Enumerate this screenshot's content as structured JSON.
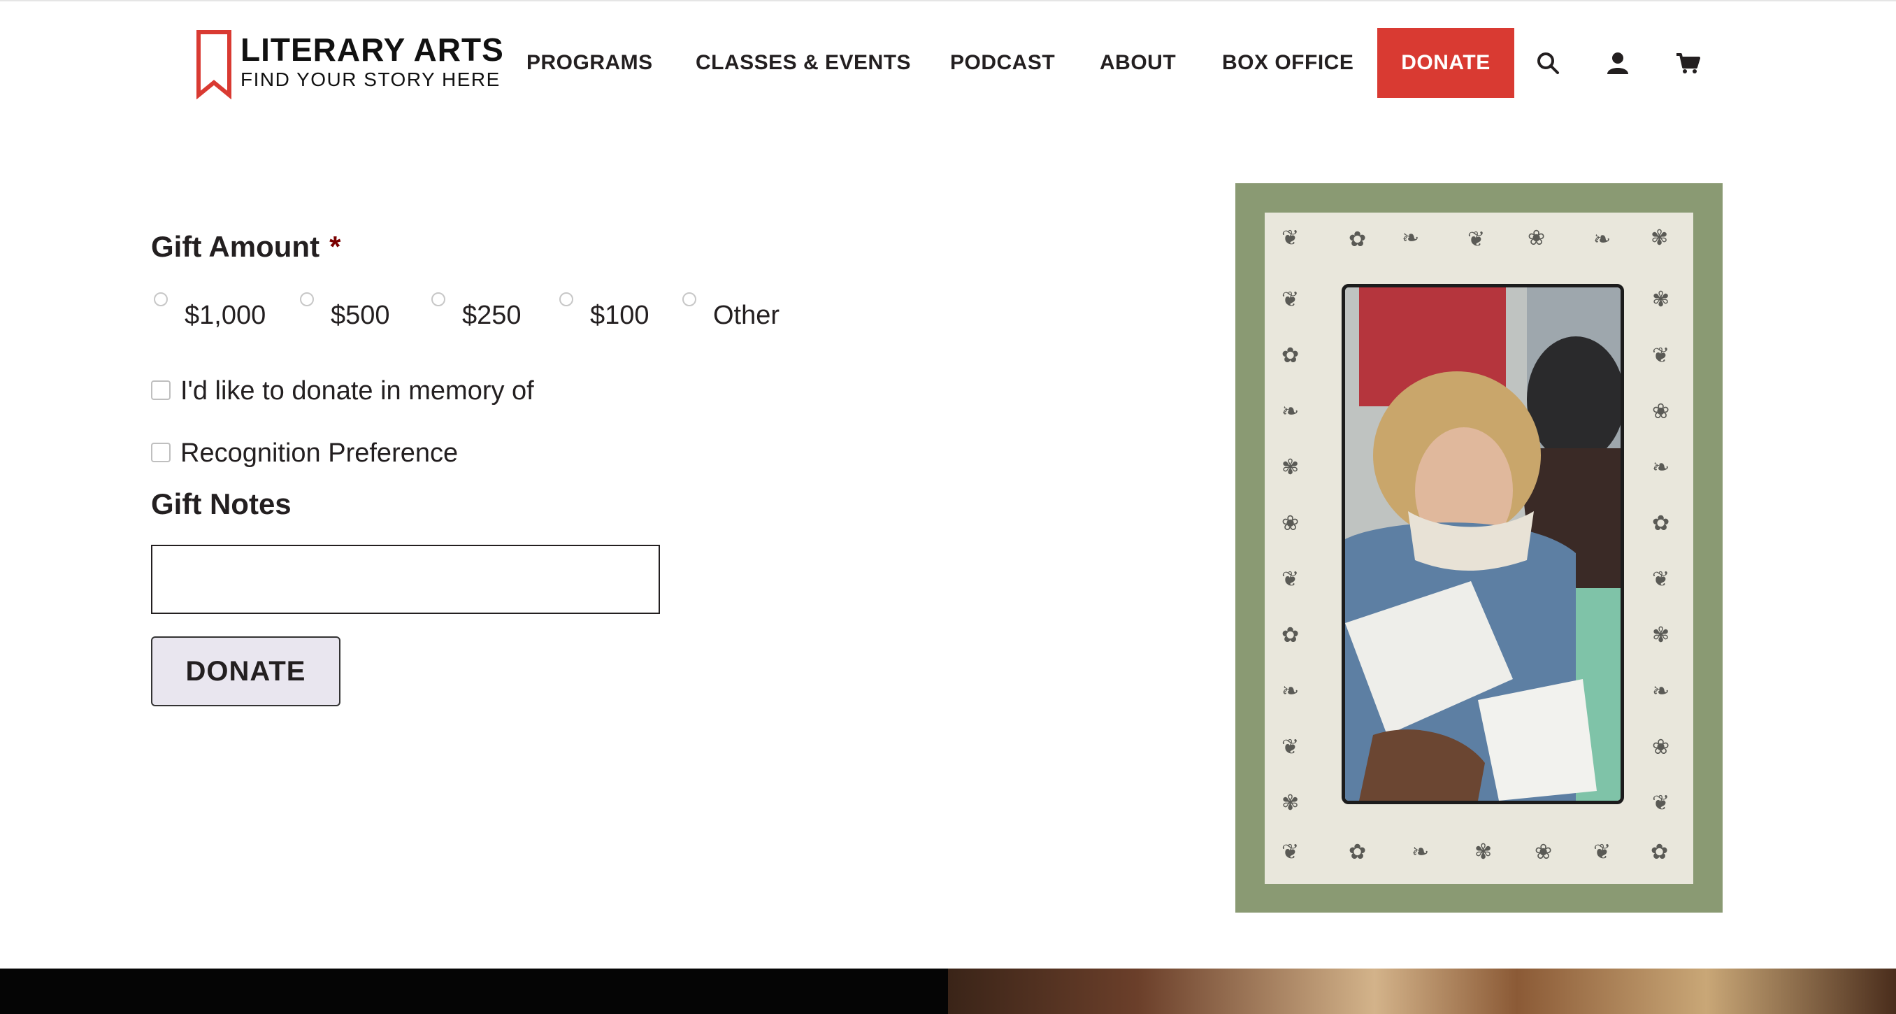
{
  "header": {
    "logo": {
      "title": "LITERARY ARTS",
      "tagline": "FIND YOUR STORY HERE",
      "color": "#d93a32"
    },
    "nav": {
      "programs": "PROGRAMS",
      "classes_events": "CLASSES & EVENTS",
      "podcast": "PODCAST",
      "about": "ABOUT",
      "box_office": "BOX OFFICE",
      "donate": "DONATE"
    },
    "icons": [
      "search-icon",
      "account-icon",
      "cart-icon"
    ],
    "accent_color": "#d93a32"
  },
  "form": {
    "gift_amount_label": "Gift Amount",
    "required_marker": "*",
    "amount_options": [
      "$1,000",
      "$500",
      "$250",
      "$100",
      "Other"
    ],
    "memory_checkbox": "I'd like to donate in memory of",
    "recognition_checkbox": "Recognition Preference",
    "gift_notes_label": "Gift Notes",
    "gift_notes_value": "",
    "submit_label": "DONATE"
  },
  "aside": {
    "frame_color": "#8a9a73",
    "image_icon": "photo-icon"
  }
}
